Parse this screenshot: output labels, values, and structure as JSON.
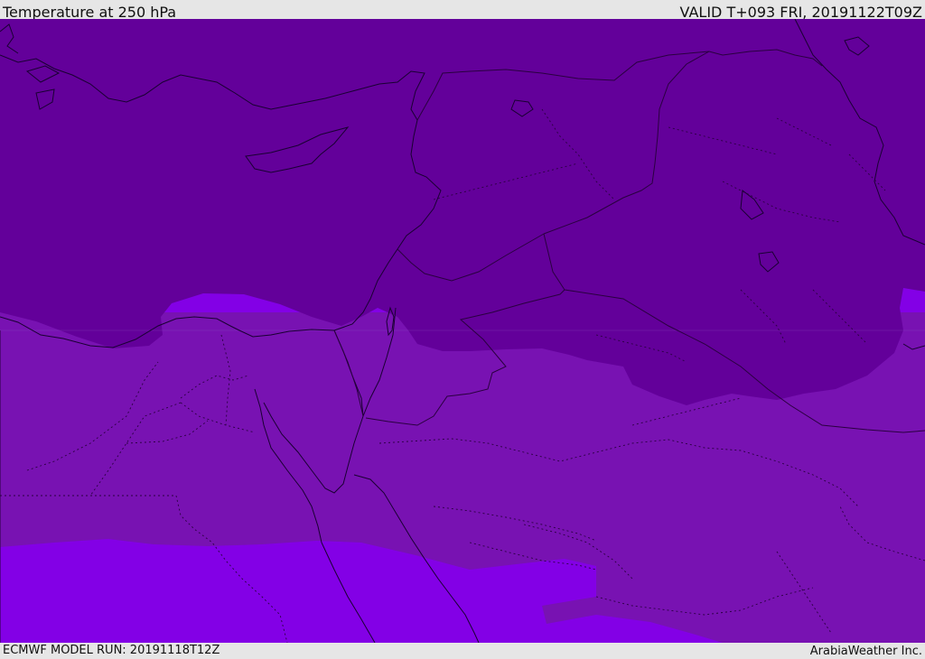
{
  "header": {
    "title": "Temperature at 250 hPa",
    "valid_time": "VALID T+093 FRI, 20191122T09Z"
  },
  "footer": {
    "model_run": "ECMWF MODEL RUN: 20191118T12Z",
    "credit": "ArabiaWeather Inc."
  },
  "map": {
    "field": "Temperature at 250 hPa",
    "region": "Eastern Mediterranean / Middle East",
    "colors": {
      "coldest_band": "#63009a",
      "middle_band": "#7812b2",
      "warmest_band": "#8300e6",
      "coastline": "#1a0033",
      "boundary": "#2a0040"
    }
  }
}
